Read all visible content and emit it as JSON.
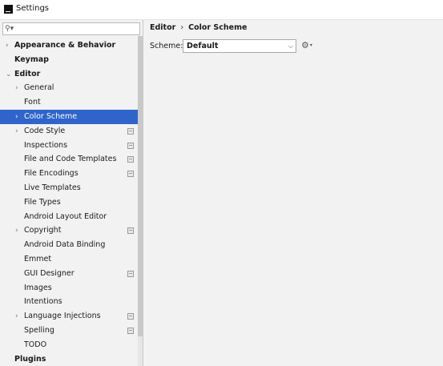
{
  "window": {
    "title": "Settings"
  },
  "search": {
    "placeholder": ""
  },
  "sidebar": {
    "items": [
      {
        "label": "Appearance & Behavior",
        "level": 0,
        "expander": "›",
        "bold": true,
        "project": false,
        "selected": false
      },
      {
        "label": "Keymap",
        "level": 0,
        "expander": "",
        "bold": true,
        "project": false,
        "selected": false
      },
      {
        "label": "Editor",
        "level": 0,
        "expander": "⌄",
        "bold": true,
        "project": false,
        "selected": false
      },
      {
        "label": "General",
        "level": 1,
        "expander": "›",
        "bold": false,
        "project": false,
        "selected": false
      },
      {
        "label": "Font",
        "level": 1,
        "expander": "",
        "bold": false,
        "project": false,
        "selected": false
      },
      {
        "label": "Color Scheme",
        "level": 1,
        "expander": "›",
        "bold": false,
        "project": false,
        "selected": true
      },
      {
        "label": "Code Style",
        "level": 1,
        "expander": "›",
        "bold": false,
        "project": true,
        "selected": false
      },
      {
        "label": "Inspections",
        "level": 1,
        "expander": "",
        "bold": false,
        "project": true,
        "selected": false
      },
      {
        "label": "File and Code Templates",
        "level": 1,
        "expander": "",
        "bold": false,
        "project": true,
        "selected": false
      },
      {
        "label": "File Encodings",
        "level": 1,
        "expander": "",
        "bold": false,
        "project": true,
        "selected": false
      },
      {
        "label": "Live Templates",
        "level": 1,
        "expander": "",
        "bold": false,
        "project": false,
        "selected": false
      },
      {
        "label": "File Types",
        "level": 1,
        "expander": "",
        "bold": false,
        "project": false,
        "selected": false
      },
      {
        "label": "Android Layout Editor",
        "level": 1,
        "expander": "",
        "bold": false,
        "project": false,
        "selected": false
      },
      {
        "label": "Copyright",
        "level": 1,
        "expander": "›",
        "bold": false,
        "project": true,
        "selected": false
      },
      {
        "label": "Android Data Binding",
        "level": 1,
        "expander": "",
        "bold": false,
        "project": false,
        "selected": false
      },
      {
        "label": "Emmet",
        "level": 1,
        "expander": "",
        "bold": false,
        "project": false,
        "selected": false
      },
      {
        "label": "GUI Designer",
        "level": 1,
        "expander": "",
        "bold": false,
        "project": true,
        "selected": false
      },
      {
        "label": "Images",
        "level": 1,
        "expander": "",
        "bold": false,
        "project": false,
        "selected": false
      },
      {
        "label": "Intentions",
        "level": 1,
        "expander": "",
        "bold": false,
        "project": false,
        "selected": false
      },
      {
        "label": "Language Injections",
        "level": 1,
        "expander": "›",
        "bold": false,
        "project": true,
        "selected": false
      },
      {
        "label": "Spelling",
        "level": 1,
        "expander": "",
        "bold": false,
        "project": true,
        "selected": false
      },
      {
        "label": "TODO",
        "level": 1,
        "expander": "",
        "bold": false,
        "project": false,
        "selected": false
      },
      {
        "label": "Plugins",
        "level": 0,
        "expander": "",
        "bold": true,
        "project": false,
        "selected": false
      }
    ]
  },
  "content": {
    "breadcrumb": {
      "parent": "Editor",
      "separator": "›",
      "current": "Color Scheme"
    },
    "scheme": {
      "label": "Scheme:",
      "value": "Default"
    }
  },
  "colors": {
    "selection": "#2f65ca",
    "sidebar_bg": "#f2f2f2",
    "content_bg": "#f2f2f2"
  },
  "icons": {
    "search": "search-icon",
    "gear": "gear-icon",
    "chevron": "chevron-down-icon",
    "app": "app-icon"
  }
}
